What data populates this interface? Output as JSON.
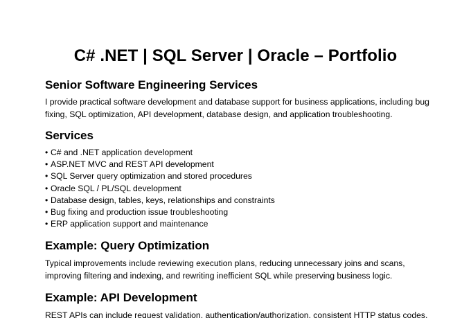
{
  "document": {
    "title": "C# .NET | SQL Server | Oracle – Portfolio",
    "intro_heading": "Senior Software Engineering Services",
    "intro_lines": [
      "I provide practical software development and database support for business applications, including bug",
      "fixing, SQL optimization, API development, database design, and application troubleshooting."
    ],
    "services_heading": "Services",
    "bullet_glyph": "•",
    "services": [
      "C# and .NET application development",
      "ASP.NET MVC and REST API development",
      "SQL Server query optimization and stored procedures",
      "Oracle SQL / PL/SQL development",
      "Database design, tables, keys, relationships and constraints",
      "Bug fixing and production issue troubleshooting",
      "ERP application support and maintenance"
    ],
    "query_heading": "Example: Query Optimization",
    "query_lines": [
      "Typical improvements include reviewing execution plans, reducing unnecessary joins and scans,",
      "improving filtering and indexing, and rewriting inefficient SQL while preserving business logic."
    ],
    "api_heading": "Example: API Development",
    "api_lines": [
      "REST APIs can include request validation, authentication/authorization, consistent HTTP status codes,"
    ]
  }
}
